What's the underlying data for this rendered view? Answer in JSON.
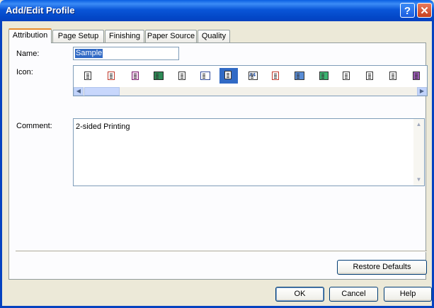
{
  "window": {
    "title": "Add/Edit Profile",
    "help_glyph": "?",
    "close_glyph": "✕"
  },
  "tabs": [
    {
      "label": "Attribution",
      "active": true
    },
    {
      "label": "Page Setup",
      "active": false
    },
    {
      "label": "Finishing",
      "active": false
    },
    {
      "label": "Paper Source",
      "active": false
    },
    {
      "label": "Quality",
      "active": false
    }
  ],
  "form": {
    "name_label": "Name:",
    "name_value": "Sample",
    "icon_label": "Icon:",
    "comment_label": "Comment:",
    "comment_value": "2-sided Printing"
  },
  "icons": {
    "selected_index": 6,
    "items": [
      "document-icon",
      "document-red-icon",
      "document-staple-icon",
      "document-image-icon",
      "document-lines-icon",
      "document-multi-icon",
      "document-duplex-icon",
      "document-a4-icon",
      "document-color-icon",
      "document-photo-icon",
      "document-booklet-icon",
      "document-gray-icon",
      "document-text-icon",
      "document-small-icon",
      "document-rainbow-icon",
      "document-arrow-icon"
    ],
    "a4_text": "A4"
  },
  "buttons": {
    "restore": "Restore Defaults",
    "ok": "OK",
    "cancel": "Cancel",
    "help": "Help"
  },
  "colors": {
    "title_bar": "#0A56D8",
    "tab_highlight": "#E68B2C",
    "selection": "#316AC5",
    "dialog_bg": "#ECE9D8"
  }
}
